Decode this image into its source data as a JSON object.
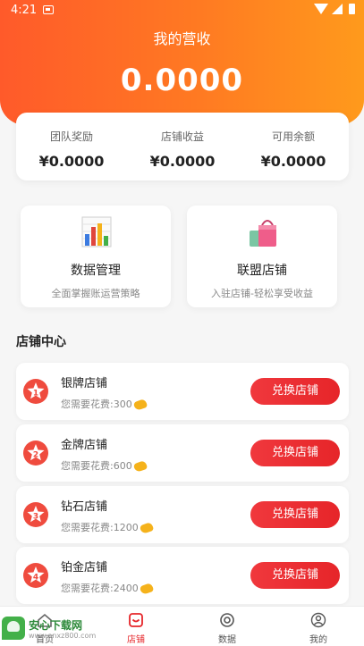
{
  "status_bar": {
    "time": "4:21"
  },
  "header": {
    "title": "我的营收",
    "total": "0.0000"
  },
  "stats": [
    {
      "label": "团队奖励",
      "value": "¥0.0000"
    },
    {
      "label": "店铺收益",
      "value": "¥0.0000"
    },
    {
      "label": "可用余额",
      "value": "¥0.0000"
    }
  ],
  "features": [
    {
      "title": "数据管理",
      "subtitle": "全面掌握账运营策略",
      "icon": "bar-chart-icon"
    },
    {
      "title": "联盟店铺",
      "subtitle": "入驻店铺-轻松享受收益",
      "icon": "shopping-bag-icon"
    }
  ],
  "section_title": "店铺中心",
  "shops": [
    {
      "rank": "1",
      "name": "银牌店铺",
      "cost": "您需要花费:300",
      "button": "兑换店铺"
    },
    {
      "rank": "2",
      "name": "金牌店铺",
      "cost": "您需要花费:600",
      "button": "兑换店铺"
    },
    {
      "rank": "3",
      "name": "钻石店铺",
      "cost": "您需要花费:1200",
      "button": "兑换店铺"
    },
    {
      "rank": "4",
      "name": "铂金店铺",
      "cost": "您需要花费:2400",
      "button": "兑换店铺"
    }
  ],
  "tabs": [
    {
      "label": "首页",
      "icon": "home-icon",
      "active": false
    },
    {
      "label": "店铺",
      "icon": "shop-icon",
      "active": true
    },
    {
      "label": "数据",
      "icon": "data-icon",
      "active": false
    },
    {
      "label": "我的",
      "icon": "profile-icon",
      "active": false
    }
  ],
  "watermark": {
    "text": "安心下载网",
    "url": "www.anxz800.com",
    "badge": "安心 下载"
  },
  "colors": {
    "accent": "#ff6a22",
    "button": "#e62529",
    "badge": "#ef4b3e",
    "coin": "#f5b21b"
  }
}
